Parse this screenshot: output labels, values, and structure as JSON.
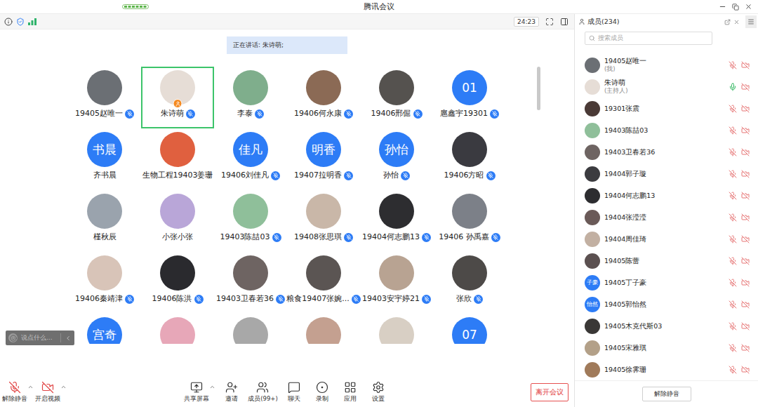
{
  "window": {
    "title": "腾讯会议"
  },
  "info_bar": {
    "timer": "24:23"
  },
  "speaking_notice": "正在讲话: 朱诗萌;",
  "participants": [
    {
      "name": "19405赵唯一",
      "kind": "photo",
      "color": "#6b6f74",
      "mic": true,
      "host": false,
      "selected": false
    },
    {
      "name": "朱诗萌",
      "kind": "photo",
      "color": "#e6ddd6",
      "mic": true,
      "host": true,
      "selected": true
    },
    {
      "name": "李泰",
      "kind": "photo",
      "color": "#7fae8c",
      "mic": true,
      "host": false,
      "selected": false
    },
    {
      "name": "19406何永康",
      "kind": "photo",
      "color": "#8b6a55",
      "mic": true,
      "host": false,
      "selected": false
    },
    {
      "name": "19406邢倔",
      "kind": "photo",
      "color": "#55524f",
      "mic": true,
      "host": false,
      "selected": false
    },
    {
      "name": "扈鑫宇19301",
      "kind": "text",
      "avatar_text": "01",
      "mic": true,
      "host": false,
      "selected": false
    },
    {
      "name": "齐书晨",
      "kind": "text",
      "avatar_text": "书晨",
      "mic": false,
      "host": false,
      "selected": false
    },
    {
      "name": "生物工程19403姜珊",
      "kind": "photo",
      "color": "#e0603f",
      "mic": false,
      "host": false,
      "selected": false
    },
    {
      "name": "19406刘佳凡",
      "kind": "text",
      "avatar_text": "佳凡",
      "mic": true,
      "host": false,
      "selected": false
    },
    {
      "name": "19407拉明香",
      "kind": "text",
      "avatar_text": "明香",
      "mic": true,
      "host": false,
      "selected": false
    },
    {
      "name": "孙怡",
      "kind": "text",
      "avatar_text": "孙怡",
      "mic": true,
      "host": false,
      "selected": false
    },
    {
      "name": "19406方昭",
      "kind": "photo",
      "color": "#3a3a40",
      "mic": true,
      "host": false,
      "selected": false
    },
    {
      "name": "槿秋辰",
      "kind": "photo",
      "color": "#9aa3ad",
      "mic": false,
      "host": false,
      "selected": false
    },
    {
      "name": "小张小张",
      "kind": "photo",
      "color": "#b9a6d8",
      "mic": false,
      "host": false,
      "selected": false
    },
    {
      "name": "19403陈喆03",
      "kind": "photo",
      "color": "#8fbf9a",
      "mic": true,
      "host": false,
      "selected": false
    },
    {
      "name": "19408张思琪",
      "kind": "photo",
      "color": "#c9b7a8",
      "mic": true,
      "host": false,
      "selected": false
    },
    {
      "name": "19404何志鹏13",
      "kind": "photo",
      "color": "#2d2d30",
      "mic": true,
      "host": false,
      "selected": false
    },
    {
      "name": "19406 孙禹嘉",
      "kind": "photo",
      "color": "#7c8088",
      "mic": true,
      "host": false,
      "selected": false
    },
    {
      "name": "19406秦靖津",
      "kind": "photo",
      "color": "#d8c4b8",
      "mic": true,
      "host": false,
      "selected": false
    },
    {
      "name": "19406陈洪",
      "kind": "photo",
      "color": "#2a2a2e",
      "mic": true,
      "host": false,
      "selected": false
    },
    {
      "name": "19403卫春若36",
      "kind": "photo",
      "color": "#6e6462",
      "mic": true,
      "host": false,
      "selected": false
    },
    {
      "name": "粮食19407张婉...",
      "kind": "photo",
      "color": "#5b5553",
      "mic": true,
      "host": false,
      "selected": false
    },
    {
      "name": "19403安宇婷21",
      "kind": "photo",
      "color": "#b8a392",
      "mic": true,
      "host": false,
      "selected": false
    },
    {
      "name": "张欣",
      "kind": "photo",
      "color": "#4d4a48",
      "mic": true,
      "host": false,
      "selected": false
    },
    {
      "kind": "text",
      "avatar_text": "宫奇",
      "mic": false,
      "host": false,
      "selected": false
    },
    {
      "kind": "photo",
      "color": "#e7a7b8",
      "mic": false,
      "host": false,
      "selected": false
    },
    {
      "kind": "photo",
      "color": "#a8a8a8",
      "mic": false,
      "host": false,
      "selected": false
    },
    {
      "kind": "photo",
      "color": "#c4a090",
      "mic": false,
      "host": false,
      "selected": false
    },
    {
      "kind": "photo",
      "color": "#d8cfc4",
      "mic": false,
      "host": false,
      "selected": false
    },
    {
      "kind": "text",
      "avatar_text": "07",
      "mic": false,
      "host": false,
      "selected": false
    }
  ],
  "chat_input": {
    "placeholder": "说点什么..."
  },
  "toolbar": {
    "left": [
      {
        "label": "解除静音",
        "kind": "mic",
        "off": true,
        "caret": true
      },
      {
        "label": "开启视频",
        "kind": "video",
        "off": true,
        "caret": true
      }
    ],
    "center": [
      {
        "label": "共享屏幕",
        "kind": "share",
        "caret": true
      },
      {
        "label": "邀请",
        "kind": "invite",
        "caret": false
      },
      {
        "label": "成员(99+)",
        "kind": "members",
        "caret": false
      },
      {
        "label": "聊天",
        "kind": "chat",
        "caret": false
      },
      {
        "label": "录制",
        "kind": "record",
        "caret": false
      },
      {
        "label": "应用",
        "kind": "apps",
        "caret": false
      },
      {
        "label": "设置",
        "kind": "settings",
        "caret": false
      }
    ],
    "leave": "离开会议"
  },
  "members_panel": {
    "title": "成员(234)",
    "search": {
      "placeholder": "搜索成员"
    },
    "members": [
      {
        "name": "19405赵唯一",
        "note": "(我)",
        "kind": "photo",
        "color": "#6b6f74",
        "mic_on": false,
        "video_on": false
      },
      {
        "name": "朱诗萌",
        "note": "(主持人)",
        "kind": "photo",
        "color": "#e6ddd6",
        "mic_on": true,
        "video_on": false
      },
      {
        "name": "19301张震",
        "kind": "photo",
        "color": "#4a3a36",
        "mic_on": false,
        "video_on": false
      },
      {
        "name": "19403陈喆03",
        "kind": "photo",
        "color": "#8fbf9a",
        "mic_on": false,
        "video_on": false
      },
      {
        "name": "19403卫春若36",
        "kind": "photo",
        "color": "#6e6462",
        "mic_on": false,
        "video_on": false
      },
      {
        "name": "19404郭子璇",
        "kind": "photo",
        "color": "#3b3b3f",
        "mic_on": false,
        "video_on": false
      },
      {
        "name": "19404何志鹏13",
        "kind": "photo",
        "color": "#2d2d30",
        "mic_on": false,
        "video_on": false
      },
      {
        "name": "19404张滢滢",
        "kind": "photo",
        "color": "#6a5a58",
        "mic_on": false,
        "video_on": false
      },
      {
        "name": "19404周佳琦",
        "kind": "photo",
        "color": "#c2b0a2",
        "mic_on": false,
        "video_on": false
      },
      {
        "name": "19405陈蕾",
        "kind": "photo",
        "color": "#5b5050",
        "mic_on": false,
        "video_on": false
      },
      {
        "name": "19405丁子豪",
        "kind": "text",
        "avatar_text": "子豪",
        "mic_on": false,
        "video_on": false
      },
      {
        "name": "19405郭怡然",
        "kind": "text",
        "avatar_text": "怡然",
        "mic_on": false,
        "video_on": false
      },
      {
        "name": "19405木克代斯03",
        "kind": "photo",
        "color": "#3a3836",
        "mic_on": false,
        "video_on": false
      },
      {
        "name": "19405宋雅琪",
        "kind": "photo",
        "color": "#b3a088",
        "mic_on": false,
        "video_on": false
      },
      {
        "name": "19405徐霁珊",
        "kind": "photo",
        "color": "#a07a5a",
        "mic_on": false,
        "video_on": false
      }
    ],
    "footer_button": "解除静音"
  }
}
